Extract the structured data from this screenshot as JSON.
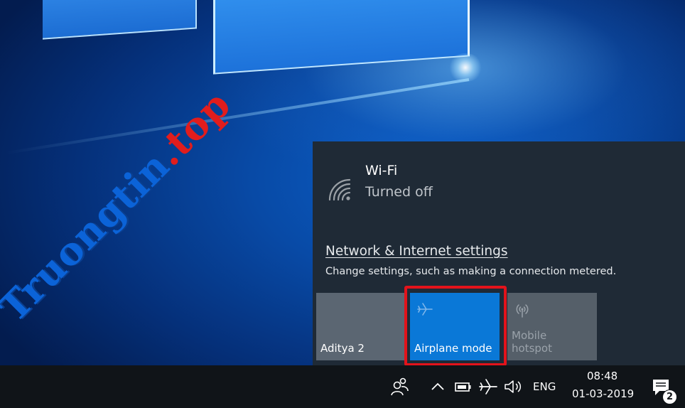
{
  "watermark": {
    "brand": "Truongtin",
    "dot": ".",
    "tld": "top"
  },
  "network_flyout": {
    "wifi": {
      "name": "Wi-Fi",
      "status": "Turned off",
      "icon": "wifi-icon"
    },
    "settings_link": "Network & Internet settings",
    "settings_description": "Change settings, such as making a connection metered.",
    "quick_actions": [
      {
        "label": "Aditya 2",
        "state": "off"
      },
      {
        "label": "Airplane mode",
        "state": "on",
        "icon": "airplane-icon"
      },
      {
        "label_line1": "Mobile",
        "label_line2": "hotspot",
        "state": "disabled",
        "icon": "hotspot-icon"
      }
    ],
    "highlight_color": "#e3131b",
    "accent_color": "#0a78d7"
  },
  "taskbar": {
    "tray_icons": [
      "people-icon",
      "chevron-up-icon",
      "battery-icon",
      "airplane-icon",
      "volume-icon"
    ],
    "language": "ENG",
    "time": "08:48",
    "date": "01-03-2019",
    "notification_count": "2"
  }
}
